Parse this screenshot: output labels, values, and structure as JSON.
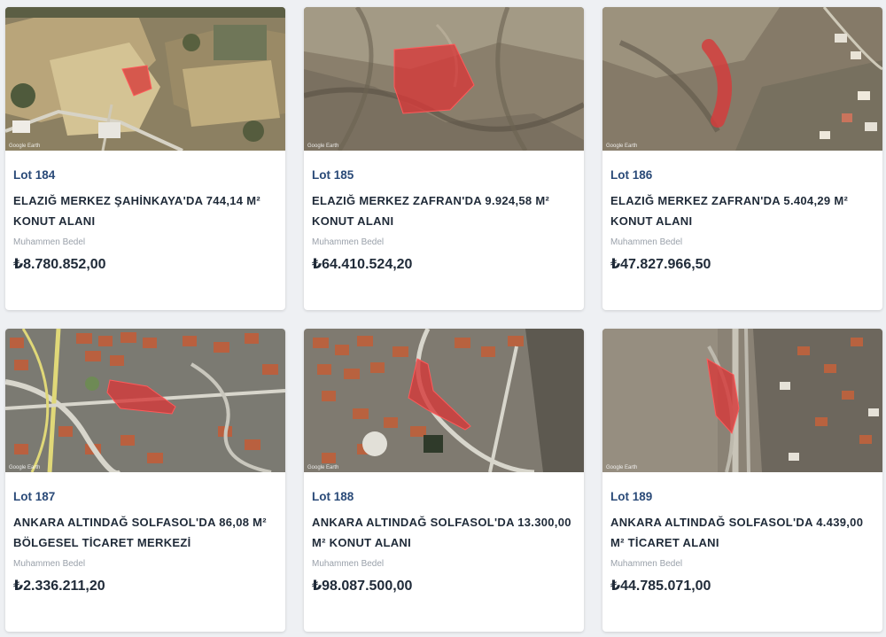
{
  "price_label": "Muhammen Bedel",
  "map_watermark": "Google Earth",
  "lots": [
    {
      "lot": "Lot 184",
      "title": "ELAZIĞ MERKEZ ŞAHİNKAYA'DA 744,14 M² KONUT ALANI",
      "price": "₺8.780.852,00"
    },
    {
      "lot": "Lot 185",
      "title": "ELAZIĞ MERKEZ ZAFRAN'DA 9.924,58 M² KONUT ALANI",
      "price": "₺64.410.524,20"
    },
    {
      "lot": "Lot 186",
      "title": "ELAZIĞ MERKEZ ZAFRAN'DA 5.404,29 M² KONUT ALANI",
      "price": "₺47.827.966,50"
    },
    {
      "lot": "Lot 187",
      "title": "ANKARA ALTINDAĞ SOLFASOL'DA 86,08 M² BÖLGESEL TİCARET MERKEZİ",
      "price": "₺2.336.211,20"
    },
    {
      "lot": "Lot 188",
      "title": "ANKARA ALTINDAĞ SOLFASOL'DA 13.300,00 M² KONUT ALANI",
      "price": "₺98.087.500,00"
    },
    {
      "lot": "Lot 189",
      "title": "ANKARA ALTINDAĞ SOLFASOL'DA 4.439,00 M² TİCARET ALANI",
      "price": "₺44.785.071,00"
    }
  ],
  "colors": {
    "highlight": "#d63a3a",
    "lot_number": "#2a4a78",
    "text": "#1f2a38",
    "muted": "#9aa1aa",
    "background": "#eef0f3"
  }
}
